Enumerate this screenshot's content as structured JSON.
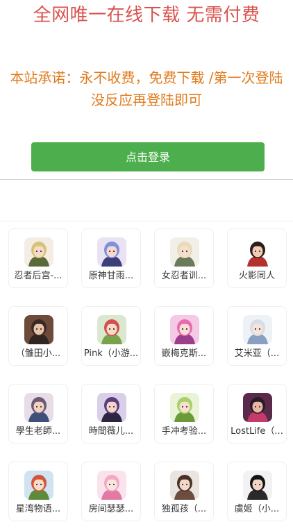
{
  "header": {
    "title": "全网唯一在线下载 无需付费",
    "promise": "本站承诺：永不收费，免费下载 /第一次登陆没反应再登陆即可"
  },
  "login_button": {
    "label": "点击登录"
  },
  "games": [
    {
      "label": "忍者后宫-...",
      "icon": "blonde-ninja-girl-icon",
      "bg": "#f3ede4",
      "hair": "#d8c27a",
      "skin": "#f6dcc6",
      "cloth": "#5a6b3a"
    },
    {
      "label": "原神甘雨...",
      "icon": "blue-hair-anime-girl-icon",
      "bg": "#e9e2f3",
      "hair": "#7f8fe0",
      "skin": "#f7d8cc",
      "cloth": "#3c3f78"
    },
    {
      "label": "女忍者训...",
      "icon": "blonde-kunoichi-icon",
      "bg": "#f1efe8",
      "hair": "#e6dcb8",
      "skin": "#f6dfcf",
      "cloth": "#6a7a5a"
    },
    {
      "label": "火影同人",
      "icon": "dark-hair-woman-icon",
      "bg": "#ffffff",
      "hair": "#2a1f1c",
      "skin": "#f2cdb4",
      "cloth": "#b5312e"
    },
    {
      "label": "（雏田小...",
      "icon": "dark-scene-girl-icon",
      "bg": "#6e4a3a",
      "hair": "#3b2a24",
      "skin": "#e9c3a8",
      "cloth": "#2f2522"
    },
    {
      "label": "Pink（小游...",
      "icon": "pink-hair-chibi-icon",
      "bg": "#dbe8d0",
      "hair": "#d74f4f",
      "skin": "#f8dcc8",
      "cloth": "#7aa14b"
    },
    {
      "label": "嵌梅克斯...",
      "icon": "pink-twin-tail-girl-icon",
      "bg": "#f4c9e4",
      "hair": "#e86bb0",
      "skin": "#f8e0d8",
      "cloth": "#9c3f8a"
    },
    {
      "label": "艾米亚（...",
      "icon": "silver-hair-girl-icon",
      "bg": "#eef2f6",
      "hair": "#d7dde6",
      "skin": "#f6e3da",
      "cloth": "#8aa0c2"
    },
    {
      "label": "學生老師...",
      "icon": "teacher-woman-icon",
      "bg": "#e6dde6",
      "hair": "#6d5a72",
      "skin": "#f2d2c3",
      "cloth": "#3f4e7a"
    },
    {
      "label": "時間薇儿...",
      "icon": "purple-hair-girl-icon",
      "bg": "#d9cfe8",
      "hair": "#5a3e7c",
      "skin": "#f5d6cc",
      "cloth": "#2d2640"
    },
    {
      "label": "手冲考验...",
      "icon": "green-hair-girl-icon",
      "bg": "#e8f3d8",
      "hair": "#a8d06a",
      "skin": "#f8dfcf",
      "cloth": "#6c9a3a"
    },
    {
      "label": "LostLife（...",
      "icon": "red-scene-game-icon",
      "bg": "#5a2a4a",
      "hair": "#2b1a2a",
      "skin": "#e8b7a3",
      "cloth": "#c43a6a"
    },
    {
      "label": "星湾物语...",
      "icon": "red-hair-farmer-girl-icon",
      "bg": "#cfe3f0",
      "hair": "#d2553e",
      "skin": "#f8dcc8",
      "cloth": "#5f8a3a"
    },
    {
      "label": "房间瑟瑟...",
      "icon": "pink-bunny-girl-icon",
      "bg": "#fbe3ec",
      "hair": "#f2a9c7",
      "skin": "#f9e6df",
      "cloth": "#e17aa5"
    },
    {
      "label": "独孤孩（...",
      "icon": "brown-hair-girl-icon",
      "bg": "#e9e4df",
      "hair": "#4a3128",
      "skin": "#f3d8c8",
      "cloth": "#6b4e3f"
    },
    {
      "label": "虞姬（小...",
      "icon": "black-hat-girl-icon",
      "bg": "#f2f2f2",
      "hair": "#141414",
      "skin": "#f1d6c6",
      "cloth": "#2a2a2a"
    }
  ]
}
